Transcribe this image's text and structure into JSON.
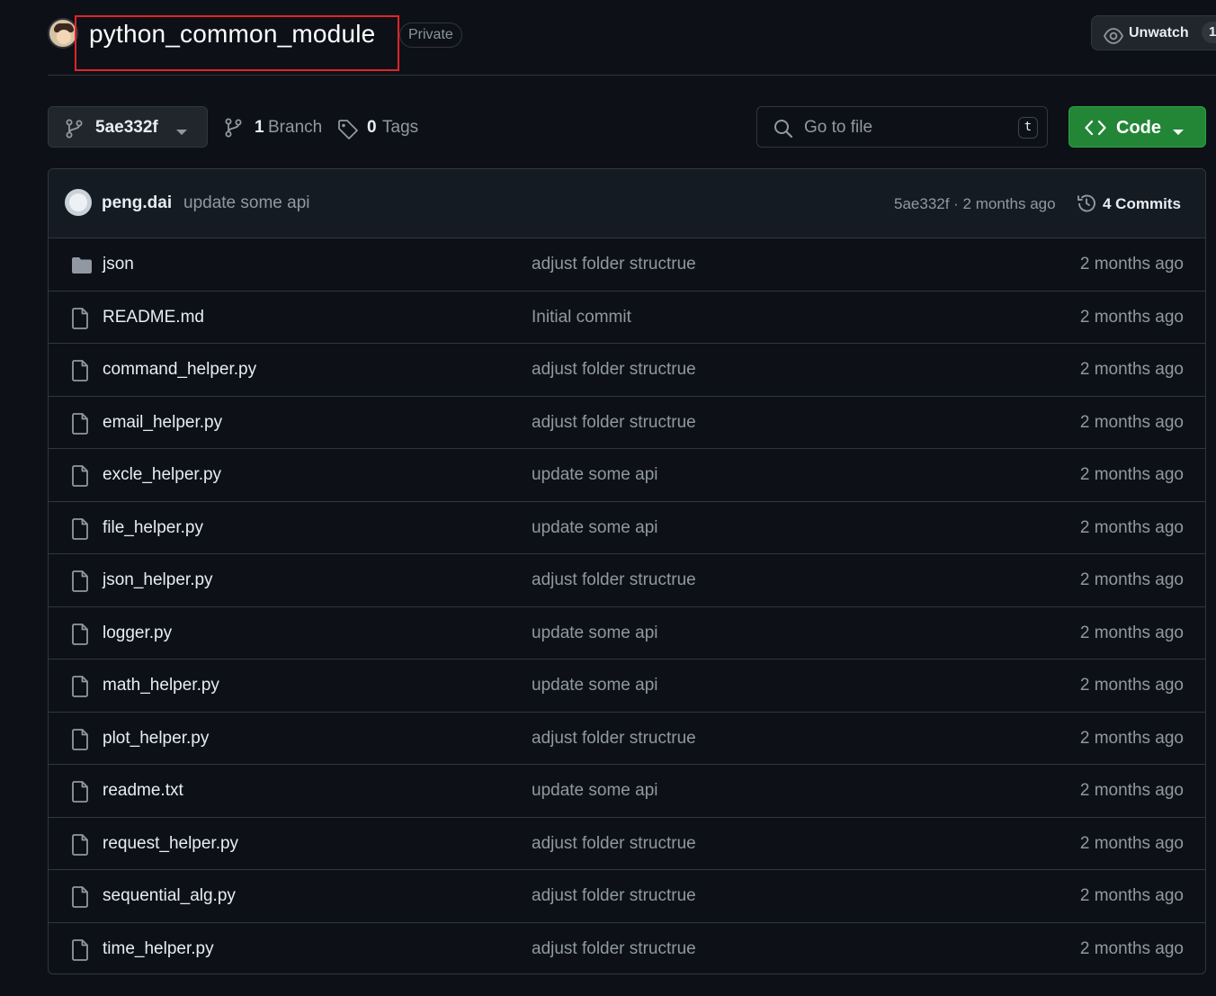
{
  "header": {
    "repo_name": "python_common_module",
    "visibility_badge": "Private",
    "watch_label": "Unwatch",
    "watch_count": "1"
  },
  "toolbar": {
    "branch_ref": "5ae332f",
    "branch_count": "1",
    "branch_label": "Branch",
    "tag_count": "0",
    "tag_label": "Tags",
    "search_placeholder": "Go to file",
    "search_shortcut": "t",
    "code_label": "Code"
  },
  "latest_commit": {
    "author": "peng.dai",
    "message": "update some api",
    "meta": "5ae332f · 2 months ago",
    "commits_label": "4 Commits"
  },
  "files": [
    {
      "name": "json",
      "type": "folder",
      "message": "adjust folder structrue",
      "time": "2 months ago"
    },
    {
      "name": "README.md",
      "type": "file",
      "message": "Initial commit",
      "time": "2 months ago"
    },
    {
      "name": "command_helper.py",
      "type": "file",
      "message": "adjust folder structrue",
      "time": "2 months ago"
    },
    {
      "name": "email_helper.py",
      "type": "file",
      "message": "adjust folder structrue",
      "time": "2 months ago"
    },
    {
      "name": "excle_helper.py",
      "type": "file",
      "message": "update some api",
      "time": "2 months ago"
    },
    {
      "name": "file_helper.py",
      "type": "file",
      "message": "update some api",
      "time": "2 months ago"
    },
    {
      "name": "json_helper.py",
      "type": "file",
      "message": "adjust folder structrue",
      "time": "2 months ago"
    },
    {
      "name": "logger.py",
      "type": "file",
      "message": "update some api",
      "time": "2 months ago"
    },
    {
      "name": "math_helper.py",
      "type": "file",
      "message": "update some api",
      "time": "2 months ago"
    },
    {
      "name": "plot_helper.py",
      "type": "file",
      "message": "adjust folder structrue",
      "time": "2 months ago"
    },
    {
      "name": "readme.txt",
      "type": "file",
      "message": "update some api",
      "time": "2 months ago"
    },
    {
      "name": "request_helper.py",
      "type": "file",
      "message": "adjust folder structrue",
      "time": "2 months ago"
    },
    {
      "name": "sequential_alg.py",
      "type": "file",
      "message": "adjust folder structrue",
      "time": "2 months ago"
    },
    {
      "name": "time_helper.py",
      "type": "file",
      "message": "adjust folder structrue",
      "time": "2 months ago"
    }
  ],
  "colors": {
    "background": "#0d1117",
    "border": "#30363d",
    "code_button": "#238636",
    "highlight_box": "#e0242b",
    "muted_text": "#9198a1"
  },
  "icons": {
    "avatar": "owner-avatar",
    "branch": "git-branch-icon",
    "tag": "tag-icon",
    "search": "search-icon",
    "code": "code-icon",
    "history": "history-icon",
    "folder": "folder-icon",
    "file": "file-icon",
    "eye": "eye-icon"
  }
}
